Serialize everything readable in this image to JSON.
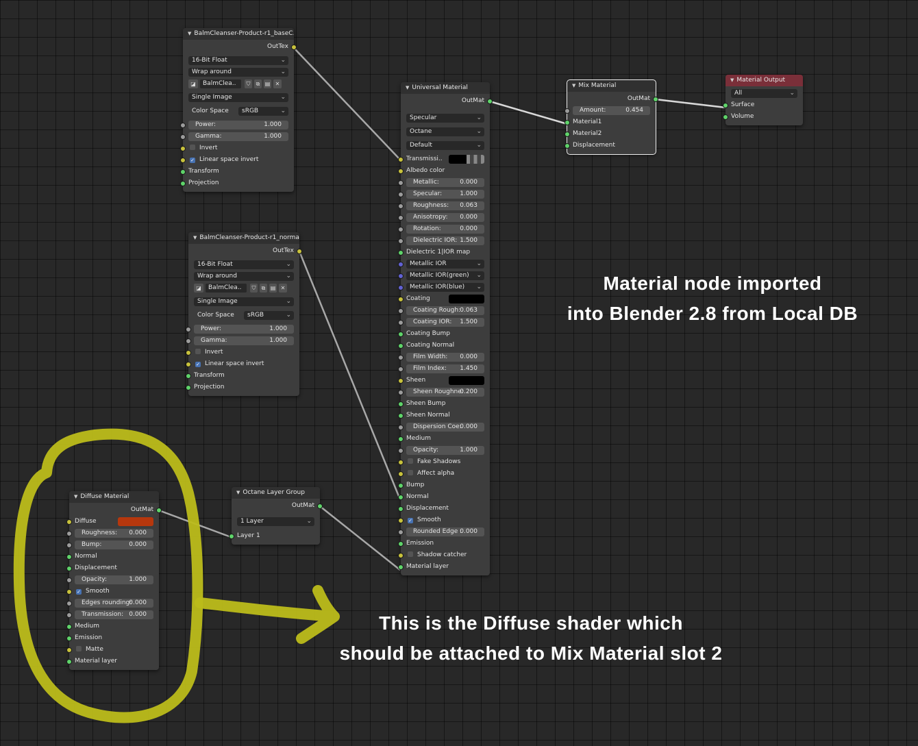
{
  "colors": {
    "accent_wire": "#a8a8a8",
    "highlight": "#bcbc1a",
    "output_header": "#7a2f39",
    "diffuse_swatch": "#b6370d"
  },
  "img_node_1": {
    "title": "BalmCleanser-Product-r1_baseC..",
    "out": "OutTex",
    "depth": "16-Bit Float",
    "wrap": "Wrap around",
    "file": "BalmClea..",
    "image_type": "Single Image",
    "cs_label": "Color Space",
    "cs_value": "sRGB",
    "power_label": "Power:",
    "power_value": "1.000",
    "gamma_label": "Gamma:",
    "gamma_value": "1.000",
    "invert": "Invert",
    "linear": "Linear space invert",
    "transform": "Transform",
    "projection": "Projection"
  },
  "img_node_2": {
    "title": "BalmCleanser-Product-r1_norma..",
    "out": "OutTex",
    "depth": "16-Bit Float",
    "wrap": "Wrap around",
    "file": "BalmClea..",
    "image_type": "Single Image",
    "cs_label": "Color Space",
    "cs_value": "sRGB",
    "power_label": "Power:",
    "power_value": "1.000",
    "gamma_label": "Gamma:",
    "gamma_value": "1.000",
    "invert": "Invert",
    "linear": "Linear space invert",
    "transform": "Transform",
    "projection": "Projection"
  },
  "universal": {
    "title": "Universal Material",
    "out": "OutMat",
    "drop1": "Specular",
    "drop2": "Octane",
    "drop3": "Default",
    "transmission": "Transmissi..",
    "albedo": "Albedo color",
    "metallic_l": "Metallic:",
    "metallic_v": "0.000",
    "specular_l": "Specular:",
    "specular_v": "1.000",
    "roughness_l": "Roughness:",
    "roughness_v": "0.063",
    "anisotropy_l": "Anisotropy:",
    "anisotropy_v": "0.000",
    "rotation_l": "Rotation:",
    "rotation_v": "0.000",
    "dielectric_l": "Dielectric IOR:",
    "dielectric_v": "1.500",
    "dielectric_map": "Dielectric 1|IOR map",
    "metallic_ior": "Metallic IOR",
    "metallic_ior_green": "Metallic IOR(green)",
    "metallic_ior_blue": "Metallic IOR(blue)",
    "coating": "Coating",
    "coating_rough_l": "Coating Rough:",
    "coating_rough_v": "0.063",
    "coating_ior_l": "Coating IOR:",
    "coating_ior_v": "1.500",
    "coating_bump": "Coating Bump",
    "coating_normal": "Coating Normal",
    "film_width_l": "Film Width:",
    "film_width_v": "0.000",
    "film_index_l": "Film Index:",
    "film_index_v": "1.450",
    "sheen": "Sheen",
    "sheen_rough_l": "Sheen Roughne:",
    "sheen_rough_v": "0.200",
    "sheen_bump": "Sheen Bump",
    "sheen_normal": "Sheen Normal",
    "dispersion_l": "Dispersion Coe:",
    "dispersion_v": "0.000",
    "medium": "Medium",
    "opacity_l": "Opacity:",
    "opacity_v": "1.000",
    "fake_shadows": "Fake Shadows",
    "affect_alpha": "Affect alpha",
    "bump": "Bump",
    "normal": "Normal",
    "displacement": "Displacement",
    "smooth": "Smooth",
    "rounded_l": "Rounded Edge :",
    "rounded_v": "0.000",
    "emission": "Emission",
    "shadow_catcher": "Shadow catcher",
    "material_layer": "Material layer"
  },
  "mix": {
    "title": "Mix Material",
    "out": "OutMat",
    "amount_l": "Amount:",
    "amount_v": "0.454",
    "material1": "Material1",
    "material2": "Material2",
    "displacement": "Displacement"
  },
  "output": {
    "title": "Material Output",
    "target": "All",
    "surface": "Surface",
    "volume": "Volume"
  },
  "layer_group": {
    "title": "Octane Layer Group",
    "out": "OutMat",
    "layers": "1 Layer",
    "layer1": "Layer 1"
  },
  "diffuse": {
    "title": "Diffuse Material",
    "out": "OutMat",
    "diffuse": "Diffuse",
    "roughness_l": "Roughness:",
    "roughness_v": "0.000",
    "bump_l": "Bump:",
    "bump_v": "0.000",
    "normal": "Normal",
    "displacement": "Displacement",
    "opacity_l": "Opacity:",
    "opacity_v": "1.000",
    "smooth": "Smooth",
    "edges_l": "Edges rounding:",
    "edges_v": "0.000",
    "transmission_l": "Transmission:",
    "transmission_v": "0.000",
    "medium": "Medium",
    "emission": "Emission",
    "matte": "Matte",
    "material_layer": "Material layer"
  },
  "annotations": {
    "note1_line1": "Material node imported",
    "note1_line2": "into Blender 2.8 from Local DB",
    "note2_line1": "This is the Diffuse shader which",
    "note2_line2": "should be attached to Mix Material slot 2"
  }
}
